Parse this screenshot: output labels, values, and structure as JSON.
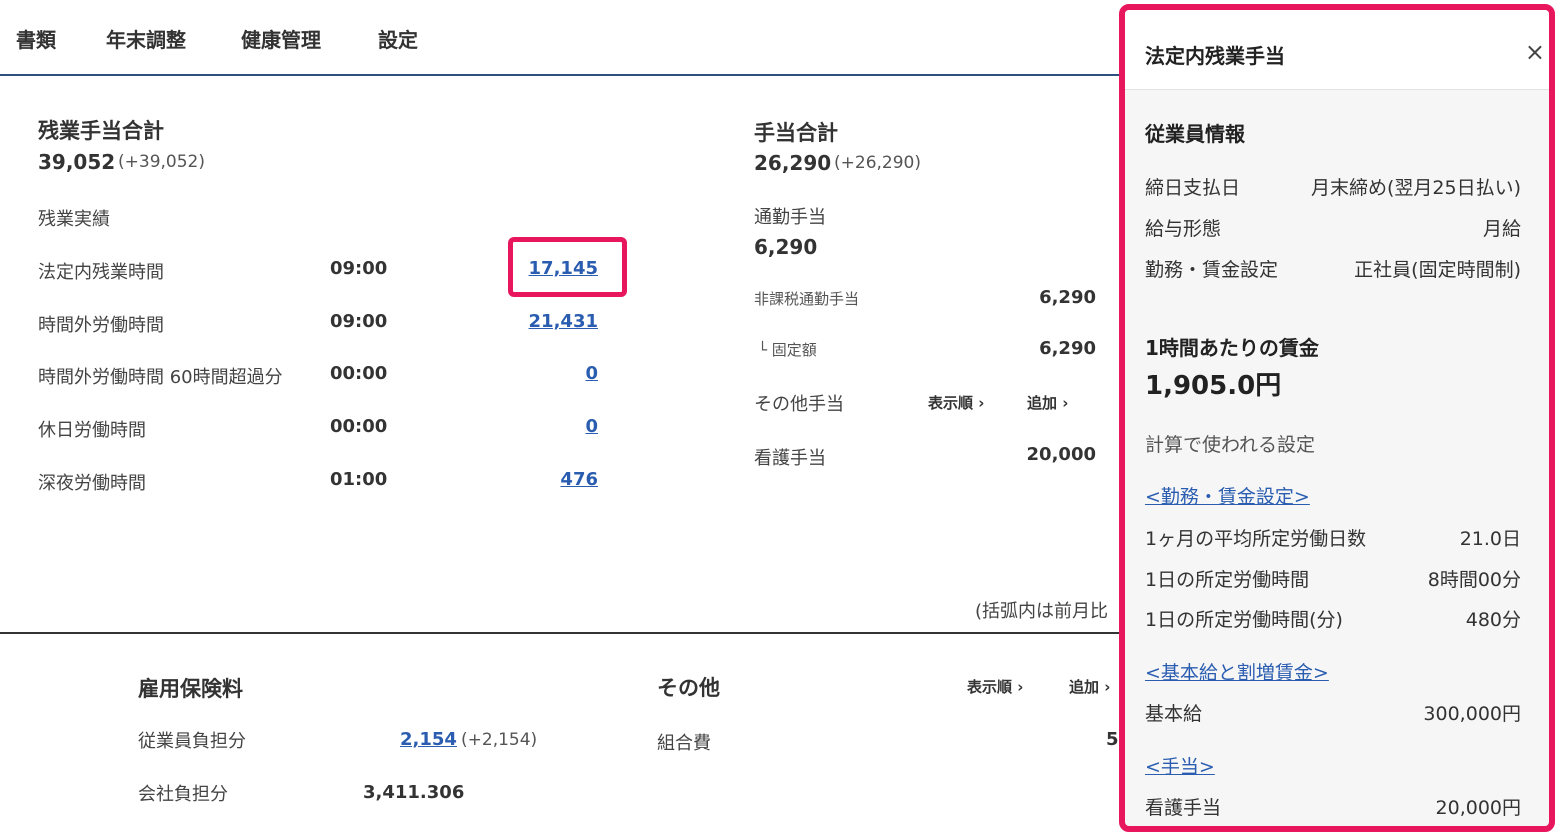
{
  "nav": {
    "tabs": [
      "書類",
      "年末調整",
      "健康管理",
      "設定"
    ]
  },
  "overtime": {
    "title": "残業手当合計",
    "total": "39,052",
    "diff": "(+39,052)",
    "section": "残業実績",
    "rows": [
      {
        "label": "法定内残業時間",
        "time": "09:00",
        "amount": "17,145"
      },
      {
        "label": "時間外労働時間",
        "time": "09:00",
        "amount": "21,431"
      },
      {
        "label": "時間外労働時間 60時間超過分",
        "time": "00:00",
        "amount": "0"
      },
      {
        "label": "休日労働時間",
        "time": "00:00",
        "amount": "0"
      },
      {
        "label": "深夜労働時間",
        "time": "01:00",
        "amount": "476"
      }
    ]
  },
  "allowance": {
    "title": "手当合計",
    "total": "26,290",
    "diff": "(+26,290)",
    "commute_title": "通勤手当",
    "commute_total": "6,290",
    "commute_rows": [
      {
        "label": "非課税通勤手当",
        "value": "6,290"
      },
      {
        "label": "└ 固定額",
        "value": "6,290"
      }
    ],
    "other_title": "その他手当",
    "order_label": "表示順 ›",
    "add_label": "追加 ›",
    "other_rows": [
      {
        "label": "看護手当",
        "value": "20,000"
      }
    ],
    "note": "(括弧内は前月比"
  },
  "insurance": {
    "title": "雇用保険料",
    "rows": [
      {
        "label": "従業員負担分",
        "value": "2,154",
        "diff": "(+2,154)"
      },
      {
        "label": "会社負担分",
        "value": "3,411.306"
      }
    ]
  },
  "others": {
    "title": "その他",
    "order_label": "表示順 ›",
    "add_label": "追加 ›",
    "rows": [
      {
        "label": "組合費",
        "value": "5"
      }
    ]
  },
  "panel": {
    "title": "法定内残業手当",
    "close": "×",
    "employee_title": "従業員情報",
    "employee_rows": [
      {
        "label": "締日支払日",
        "value": "月末締め(翌月25日払い)"
      },
      {
        "label": "給与形態",
        "value": "月給"
      },
      {
        "label": "勤務・賃金設定",
        "value": "正社員(固定時間制)"
      }
    ],
    "wage_title": "1時間あたりの賃金",
    "wage_value": "1,905.0円",
    "calc_title": "計算で使われる設定",
    "link_work": "<勤務・賃金設定>",
    "work_rows": [
      {
        "label": "1ヶ月の平均所定労働日数",
        "value": "21.0日"
      },
      {
        "label": "1日の所定労働時間",
        "value": "8時間00分"
      },
      {
        "label": "1日の所定労働時間(分)",
        "value": "480分"
      }
    ],
    "link_base": "<基本給と割増賃金>",
    "base_rows": [
      {
        "label": "基本給",
        "value": "300,000円"
      }
    ],
    "link_allow": "<手当>",
    "allow_rows": [
      {
        "label": "看護手当",
        "value": "20,000円"
      }
    ]
  },
  "colors": {
    "highlight": "#e8175d",
    "link": "#2a5db0",
    "nav_line": "#2f4f7f"
  }
}
